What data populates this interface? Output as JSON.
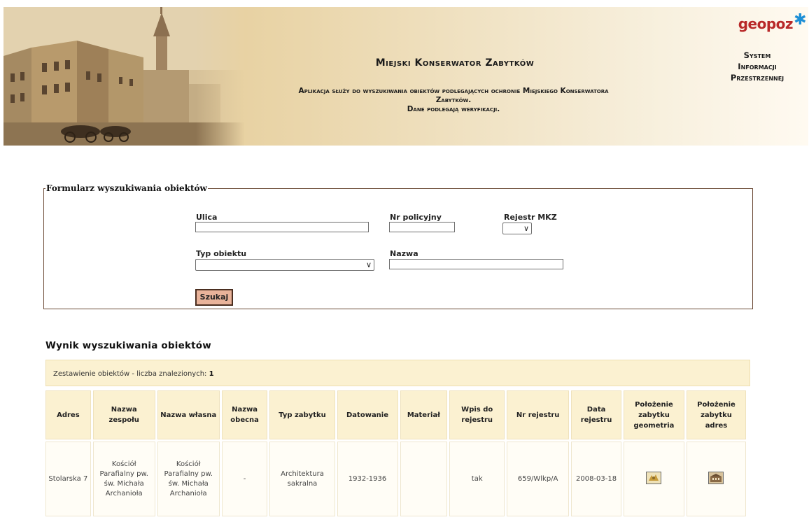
{
  "header": {
    "title": "Miejski Konserwator Zabytków",
    "subtitle_line1": "Aplikacja służy do wyszukiwania obiektów podlegających ochronie Miejskiego Konserwatora",
    "subtitle_line2": "Zabytków.",
    "subtitle_line3": "Dane podlegają weryfikacji.",
    "logo": "geopoz",
    "system_line1": "System",
    "system_line2": "Informacji",
    "system_line3": "Przestrzennej"
  },
  "form": {
    "legend": "Formularz wyszukiwania obiektów",
    "street_label": "Ulica",
    "street_value": "",
    "number_label": "Nr policyjny",
    "number_value": "",
    "registry_label": "Rejestr MKZ",
    "registry_value": "",
    "type_label": "Typ obiektu",
    "type_value": "",
    "name_label": "Nazwa",
    "name_value": "",
    "search_button": "Szukaj"
  },
  "results": {
    "title": "Wynik wyszukiwania obiektów",
    "summary_text": "Zestawienie obiektów - liczba znalezionych: ",
    "summary_count": "1",
    "columns": [
      "Adres",
      "Nazwa zespołu",
      "Nazwa własna",
      "Nazwa obecna",
      "Typ zabytku",
      "Datowanie",
      "Materiał",
      "Wpis do rejestru",
      "Nr rejestru",
      "Data rejestru",
      "Położenie zabytku geometria",
      "Położenie zabytku adres"
    ],
    "rows": [
      {
        "adres": "Stolarska 7",
        "nazwa_zespolu": "Kościół Parafialny pw. św. Michała Archanioła",
        "nazwa_wlasna": "Kościół Parafialny pw. św. Michała Archanioła",
        "nazwa_obecna": "-",
        "typ_zabytku": "Architektura sakralna",
        "datowanie": "1932-1936",
        "material": "",
        "wpis_do_rejestru": "tak",
        "nr_rejestru": "659/Wlkp/A",
        "data_rejestru": "2008-03-18",
        "geometria_icon": "map-icon",
        "adres_icon": "building-icon"
      }
    ]
  }
}
